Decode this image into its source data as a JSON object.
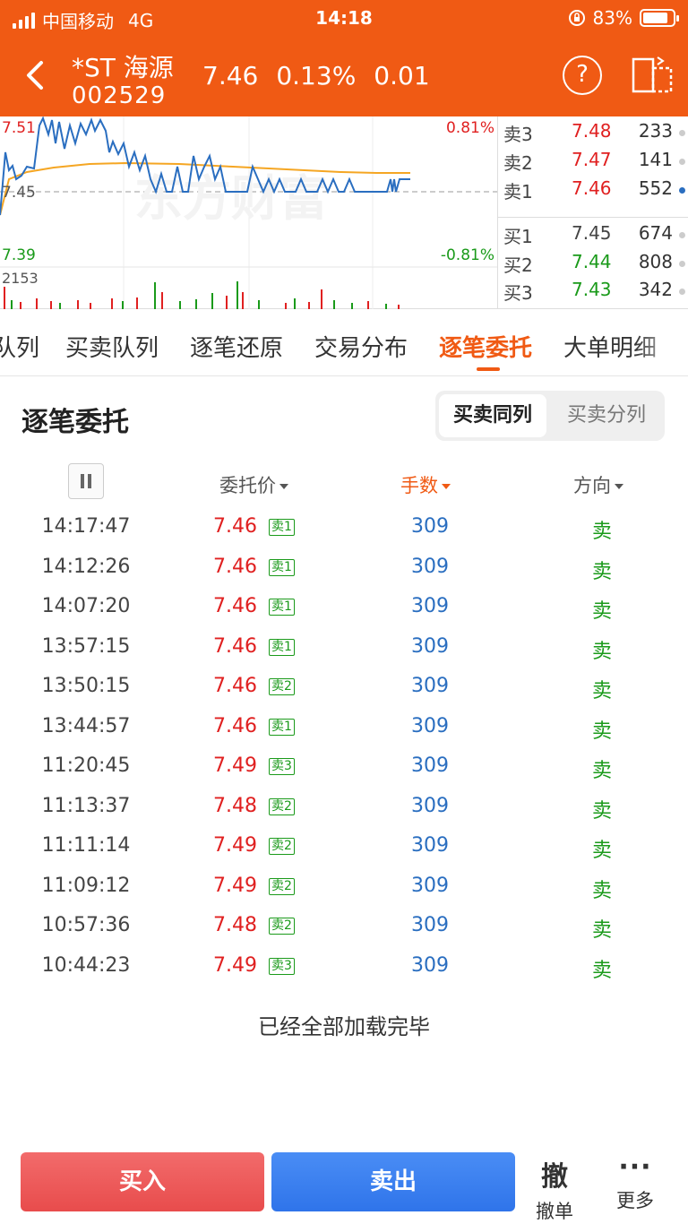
{
  "status_bar": {
    "carrier": "中国移动",
    "network": "4G",
    "time": "14:18",
    "battery": "83%"
  },
  "header": {
    "name": "*ST 海源",
    "code": "002529",
    "price": "7.46",
    "change_pct": "0.13%",
    "change": "0.01"
  },
  "chart": {
    "high_label": "7.51",
    "mid_label": "7.45",
    "low_label": "7.39",
    "up_pct": "0.81%",
    "down_pct": "-0.81%",
    "volume_label": "2153",
    "watermark": "东方财富"
  },
  "order_book": {
    "asks": [
      {
        "label": "卖3",
        "price": "7.48",
        "volume": "233"
      },
      {
        "label": "卖2",
        "price": "7.47",
        "volume": "141"
      },
      {
        "label": "卖1",
        "price": "7.46",
        "volume": "552"
      }
    ],
    "bids": [
      {
        "label": "买1",
        "price": "7.45",
        "volume": "674"
      },
      {
        "label": "买2",
        "price": "7.44",
        "volume": "808"
      },
      {
        "label": "买3",
        "price": "7.43",
        "volume": "342"
      }
    ]
  },
  "tabs": [
    "队列",
    "买卖队列",
    "逐笔还原",
    "交易分布",
    "逐笔委托",
    "大单明细"
  ],
  "section": {
    "title": "逐笔委托",
    "seg_on": "买卖同列",
    "seg_off": "买卖分列"
  },
  "columns": {
    "price": "委托价",
    "qty": "手数",
    "direction": "方向"
  },
  "rows": [
    {
      "time": "14:17:47",
      "price": "7.46",
      "badge": "卖1",
      "qty": "309",
      "dir": "卖"
    },
    {
      "time": "14:12:26",
      "price": "7.46",
      "badge": "卖1",
      "qty": "309",
      "dir": "卖"
    },
    {
      "time": "14:07:20",
      "price": "7.46",
      "badge": "卖1",
      "qty": "309",
      "dir": "卖"
    },
    {
      "time": "13:57:15",
      "price": "7.46",
      "badge": "卖1",
      "qty": "309",
      "dir": "卖"
    },
    {
      "time": "13:50:15",
      "price": "7.46",
      "badge": "卖2",
      "qty": "309",
      "dir": "卖"
    },
    {
      "time": "13:44:57",
      "price": "7.46",
      "badge": "卖1",
      "qty": "309",
      "dir": "卖"
    },
    {
      "time": "11:20:45",
      "price": "7.49",
      "badge": "卖3",
      "qty": "309",
      "dir": "卖"
    },
    {
      "time": "11:13:37",
      "price": "7.48",
      "badge": "卖2",
      "qty": "309",
      "dir": "卖"
    },
    {
      "time": "11:11:14",
      "price": "7.49",
      "badge": "卖2",
      "qty": "309",
      "dir": "卖"
    },
    {
      "time": "11:09:12",
      "price": "7.49",
      "badge": "卖2",
      "qty": "309",
      "dir": "卖"
    },
    {
      "time": "10:57:36",
      "price": "7.48",
      "badge": "卖2",
      "qty": "309",
      "dir": "卖"
    },
    {
      "time": "10:44:23",
      "price": "7.49",
      "badge": "卖3",
      "qty": "309",
      "dir": "卖"
    }
  ],
  "footer_note": "已经全部加载完毕",
  "bottom": {
    "buy": "买入",
    "sell": "卖出",
    "cancel_icon": "撤",
    "cancel": "撤单",
    "more": "更多"
  },
  "colors": {
    "brand": "#f05a14",
    "up": "#e02020",
    "down": "#1a9a1a",
    "qty": "#2a6ec0"
  }
}
